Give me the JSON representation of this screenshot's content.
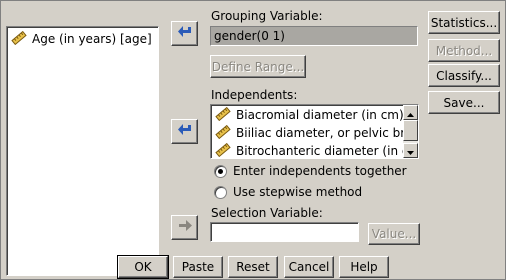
{
  "source_list": {
    "items": [
      {
        "label": "Age (in years) [age]",
        "icon": "ruler-scale-icon"
      }
    ]
  },
  "grouping": {
    "label": "Grouping Variable:",
    "value": "gender(0 1)",
    "define_range": "Define Range..."
  },
  "independents": {
    "label": "Independents:",
    "items": [
      {
        "label": "Biacromial diameter (in cm) ...",
        "icon": "ruler-scale-icon"
      },
      {
        "label": "Biiliac diameter, or pelvic br...",
        "icon": "ruler-scale-icon"
      },
      {
        "label": "Bitrochanteric diameter (in c...",
        "icon": "ruler-scale-icon"
      }
    ]
  },
  "method": {
    "options": [
      {
        "label": "Enter independents together",
        "selected": true
      },
      {
        "label": "Use stepwise method",
        "selected": false
      }
    ]
  },
  "selection": {
    "label": "Selection Variable:",
    "value": "",
    "value_button": "Value..."
  },
  "side_buttons": {
    "statistics": "Statistics...",
    "method": "Method...",
    "classify": "Classify...",
    "save": "Save..."
  },
  "bottom_buttons": {
    "ok": "OK",
    "paste": "Paste",
    "reset": "Reset",
    "cancel": "Cancel",
    "help": "Help"
  },
  "colors": {
    "dialog_bg": "#d4d0c8",
    "arrow_blue": "#2b5bb8",
    "ruler_yellow": "#e8c14a"
  }
}
